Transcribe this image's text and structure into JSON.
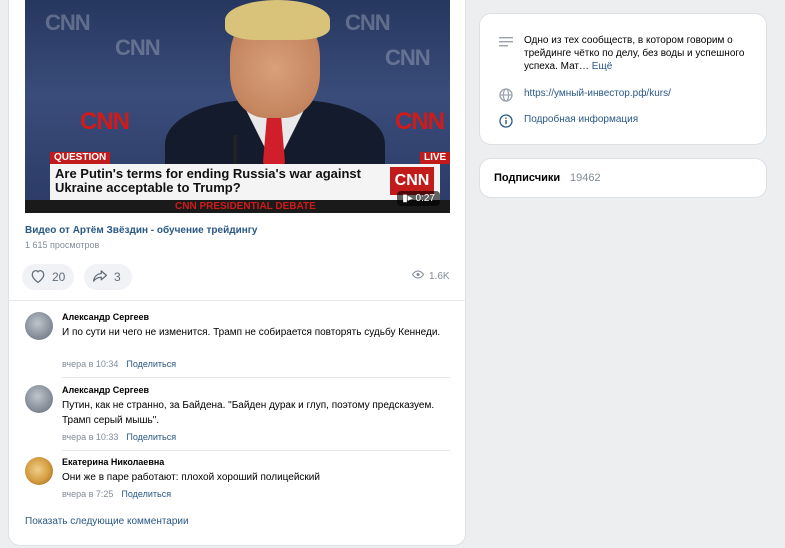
{
  "video": {
    "question_tag": "QUESTION",
    "live_tag": "LIVE",
    "caption": "Are Putin's terms for ending Russia's war against Ukraine acceptable to Trump?",
    "network_logo": "CNN",
    "debate_banner": "CNN PRESIDENTIAL DEBATE",
    "duration": "0:27",
    "title": "Видео от Артём Звёздин - обучение трейдингу",
    "views": "1 615 просмотров"
  },
  "actions": {
    "likes": "20",
    "shares": "3",
    "views_short": "1.6K"
  },
  "comments": [
    {
      "author": "Александр Сергеев",
      "text": "И по сути ни чего не изменится. Трамп не собирается повторять судьбу Кеннеди.",
      "time": "вчера в 10:34",
      "share": "Поделиться"
    },
    {
      "author": "Александр Сергеев",
      "text": "Путин, как не странно, за Байдена. \"Байден дурак и глуп, поэтому предсказуем. Трамп серый мышь\".",
      "time": "вчера в 10:33",
      "share": "Поделиться"
    },
    {
      "author": "Екатерина Николаевна",
      "text": "Они же в паре работают: плохой хороший полицейский",
      "time": "вчера в 7:25",
      "share": "Поделиться"
    }
  ],
  "show_more": "Показать следующие комментарии",
  "community": {
    "description": "Одно из тех сообществ, в котором говорим о трейдинге чётко по делу, без воды и успешного успеха. Мат…",
    "description_more": "Ещё",
    "link": "https://умный-инвестор.рф/kurs/",
    "details": "Подробная информация"
  },
  "subscribers": {
    "label": "Подписчики",
    "count": "19462"
  },
  "colors": {
    "link": "#2a5885",
    "muted": "#818c99",
    "cnn_red": "#c21b1b"
  }
}
